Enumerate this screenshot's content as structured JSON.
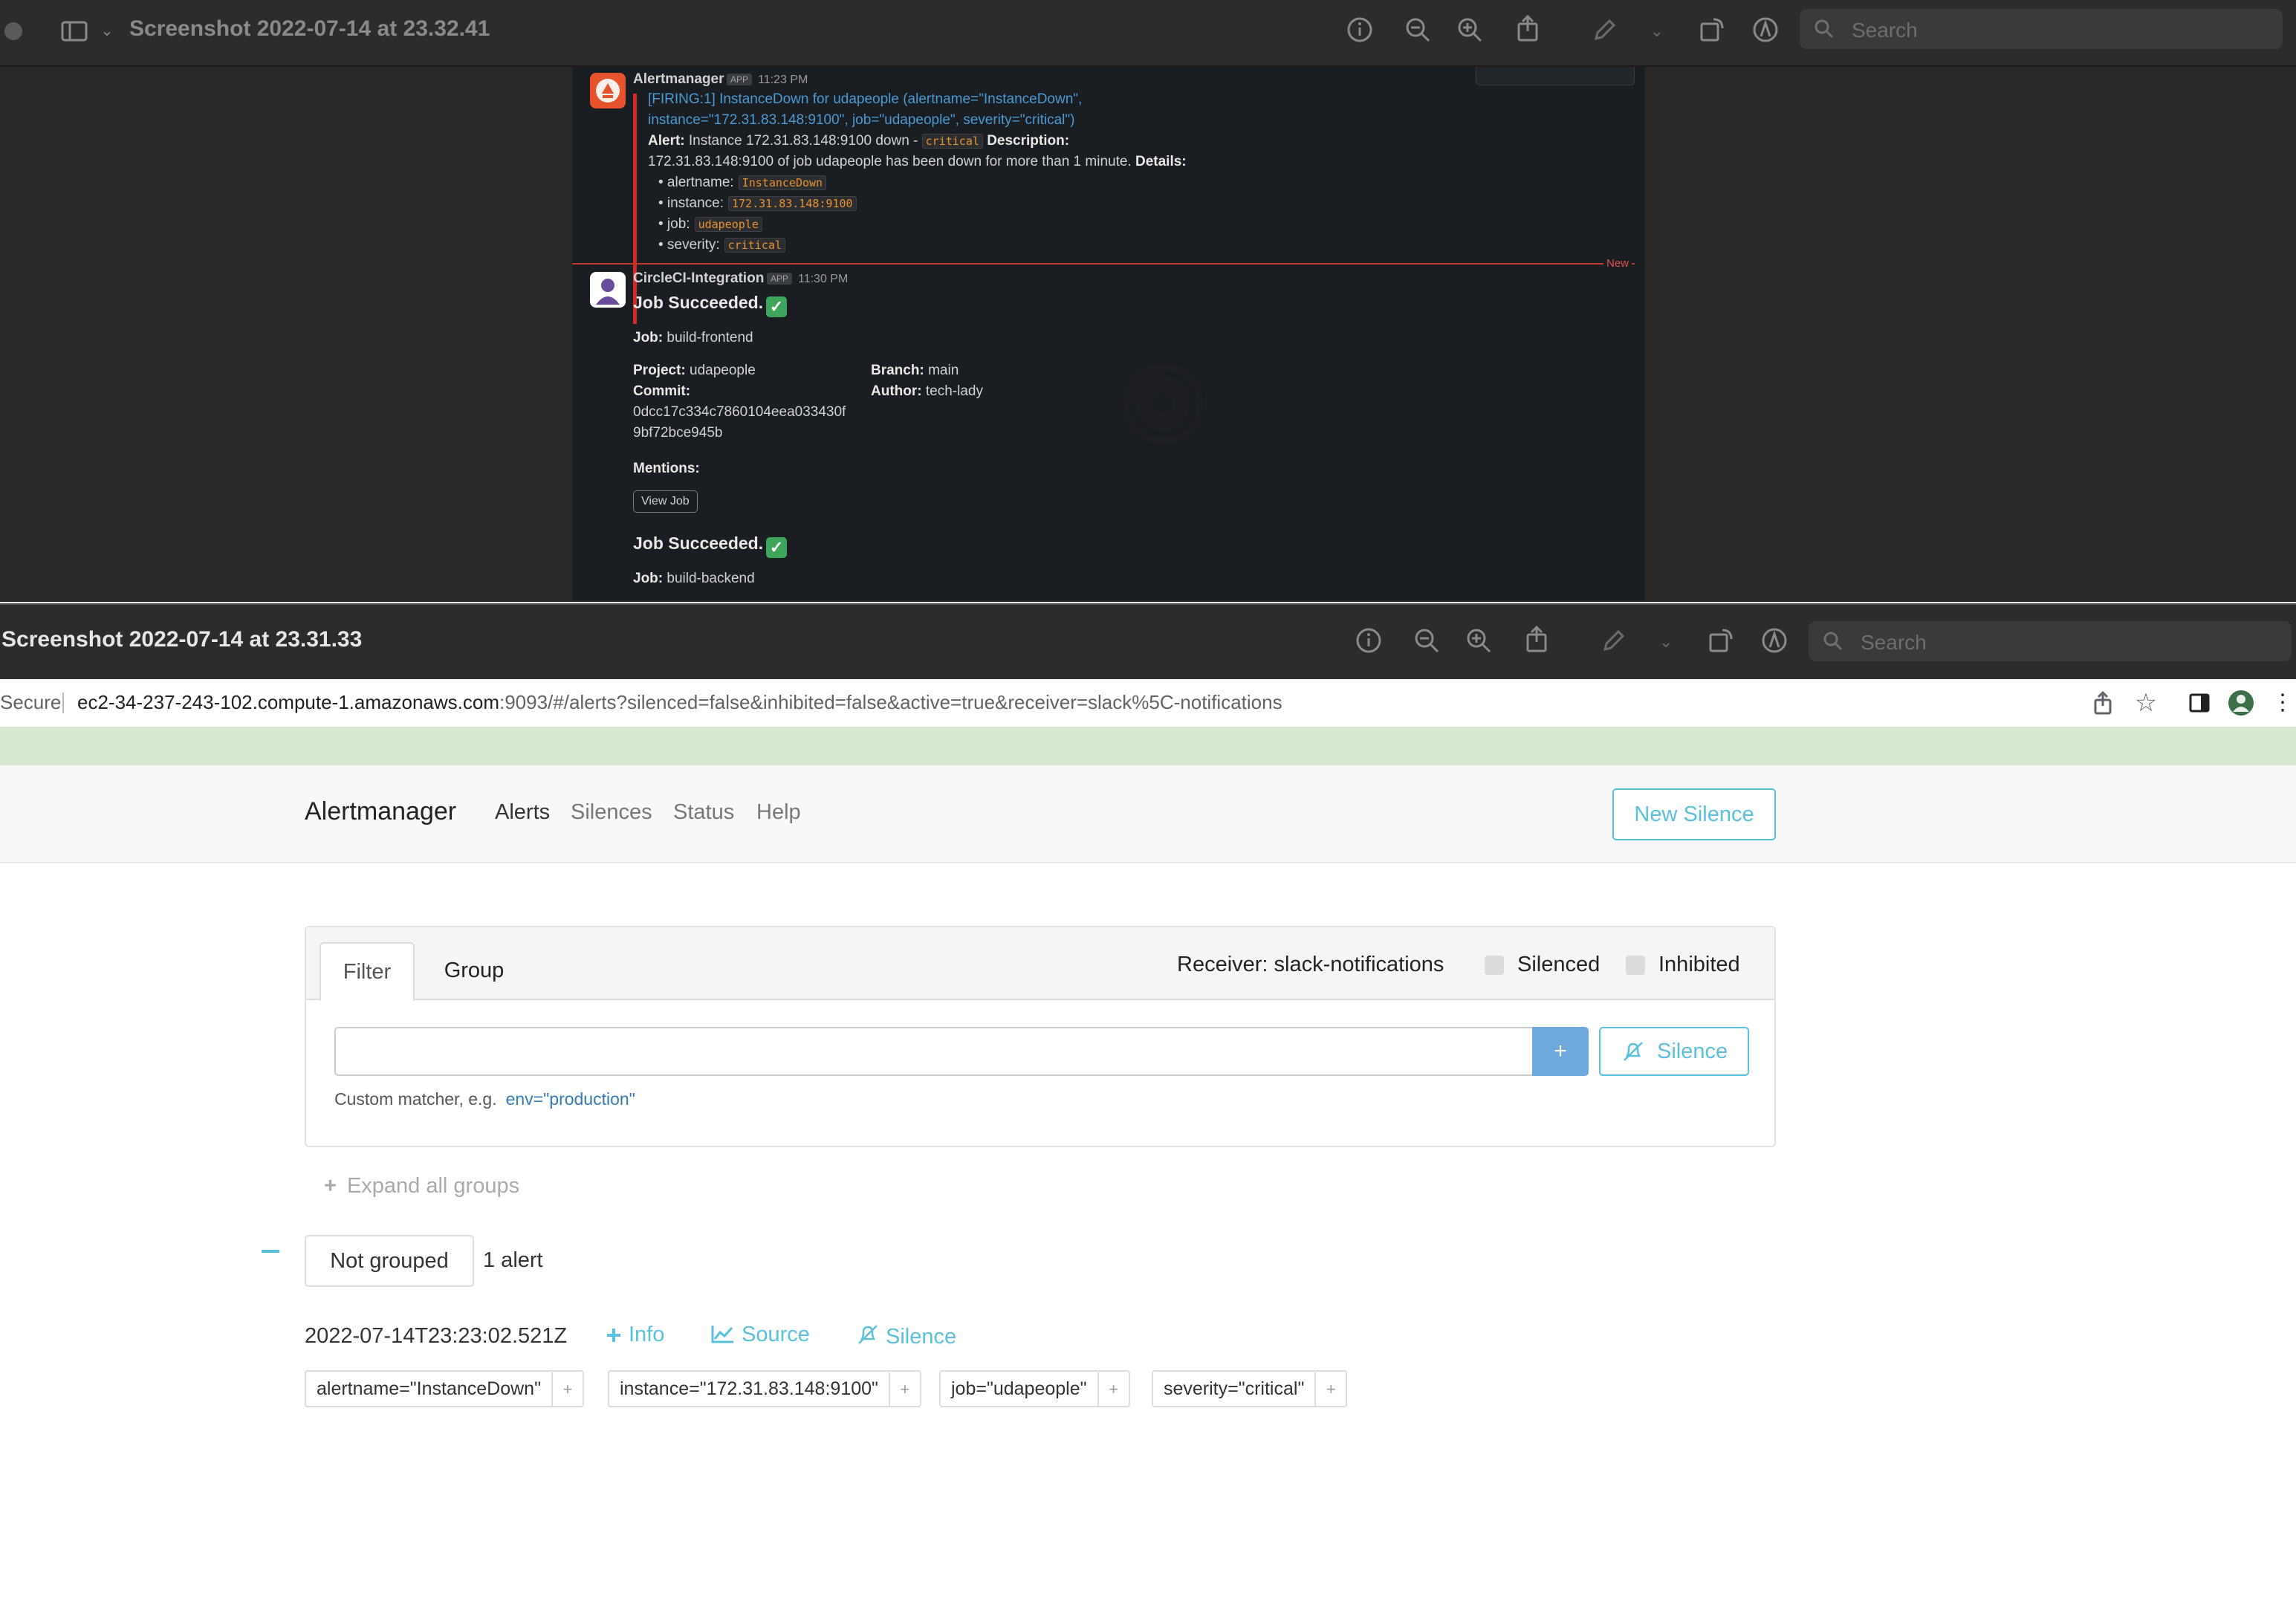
{
  "window1": {
    "title": "Screenshot 2022-07-14 at 23.32.41",
    "search_placeholder": "Search"
  },
  "slack": {
    "msg1": {
      "sender": "Alertmanager",
      "app_badge": "APP",
      "time": "11:23 PM",
      "firing_line1": "[FIRING:1] InstanceDown for udapeople (alertname=\"InstanceDown\",",
      "firing_line2": "instance=\"172.31.83.148:9100\", job=\"udapeople\", severity=\"critical\")",
      "alert_label": "Alert:",
      "alert_text": "Instance 172.31.83.148:9100 down - ",
      "alert_code": "critical",
      "description_label": "Description:",
      "desc_text": "172.31.83.148:9100 of job udapeople has been down for more than 1 minute.",
      "details_label": "Details:",
      "details": [
        {
          "key": "• alertname:",
          "value": "InstanceDown"
        },
        {
          "key": "• instance:",
          "value": "172.31.83.148:9100"
        },
        {
          "key": "• job:",
          "value": "udapeople"
        },
        {
          "key": "• severity:",
          "value": "critical"
        }
      ],
      "new_marker": "New"
    },
    "msg2": {
      "sender": "CircleCI-Integration",
      "app_badge": "APP",
      "time": "11:30 PM",
      "title1": "Job Succeeded.",
      "job_label": "Job:",
      "job1": "build-frontend",
      "project_label": "Project:",
      "project": "udapeople",
      "branch_label": "Branch:",
      "branch": "main",
      "commit_label": "Commit:",
      "author_label": "Author:",
      "author": "tech-lady",
      "commit_line1": "0dcc17c334c7860104eea033430f",
      "commit_line2": "9bf72bce945b",
      "mentions_label": "Mentions:",
      "view_job": "View Job",
      "title2": "Job Succeeded.",
      "job2": "build-backend"
    }
  },
  "window2": {
    "title": "Screenshot 2022-07-14 at 23.31.33",
    "search_placeholder": "Search"
  },
  "browser": {
    "secure_label": "Secure",
    "url_host": "ec2-34-237-243-102.compute-1.amazonaws.com",
    "url_rest": ":9093/#/alerts?silenced=false&inhibited=false&active=true&receiver=slack%5C-notifications"
  },
  "alertmanager": {
    "brand": "Alertmanager",
    "nav": [
      "Alerts",
      "Silences",
      "Status",
      "Help"
    ],
    "new_silence": "New Silence",
    "tabs": [
      "Filter",
      "Group"
    ],
    "receiver": "Receiver: slack-notifications",
    "silenced_label": "Silenced",
    "inhibited_label": "Inhibited",
    "plus": "+",
    "silence_button": "Silence",
    "hint": "Custom matcher, e.g.",
    "hint_example": "env=\"production\"",
    "expand_all": "Expand all groups",
    "group_label": "Not grouped",
    "alert_count": "1 alert",
    "alert": {
      "timestamp": "2022-07-14T23:23:02.521Z",
      "info": "Info",
      "source": "Source",
      "silence": "Silence",
      "labels": [
        "alertname=\"InstanceDown\"",
        "instance=\"172.31.83.148:9100\"",
        "job=\"udapeople\"",
        "severity=\"critical\""
      ],
      "label_plus": "+"
    }
  }
}
